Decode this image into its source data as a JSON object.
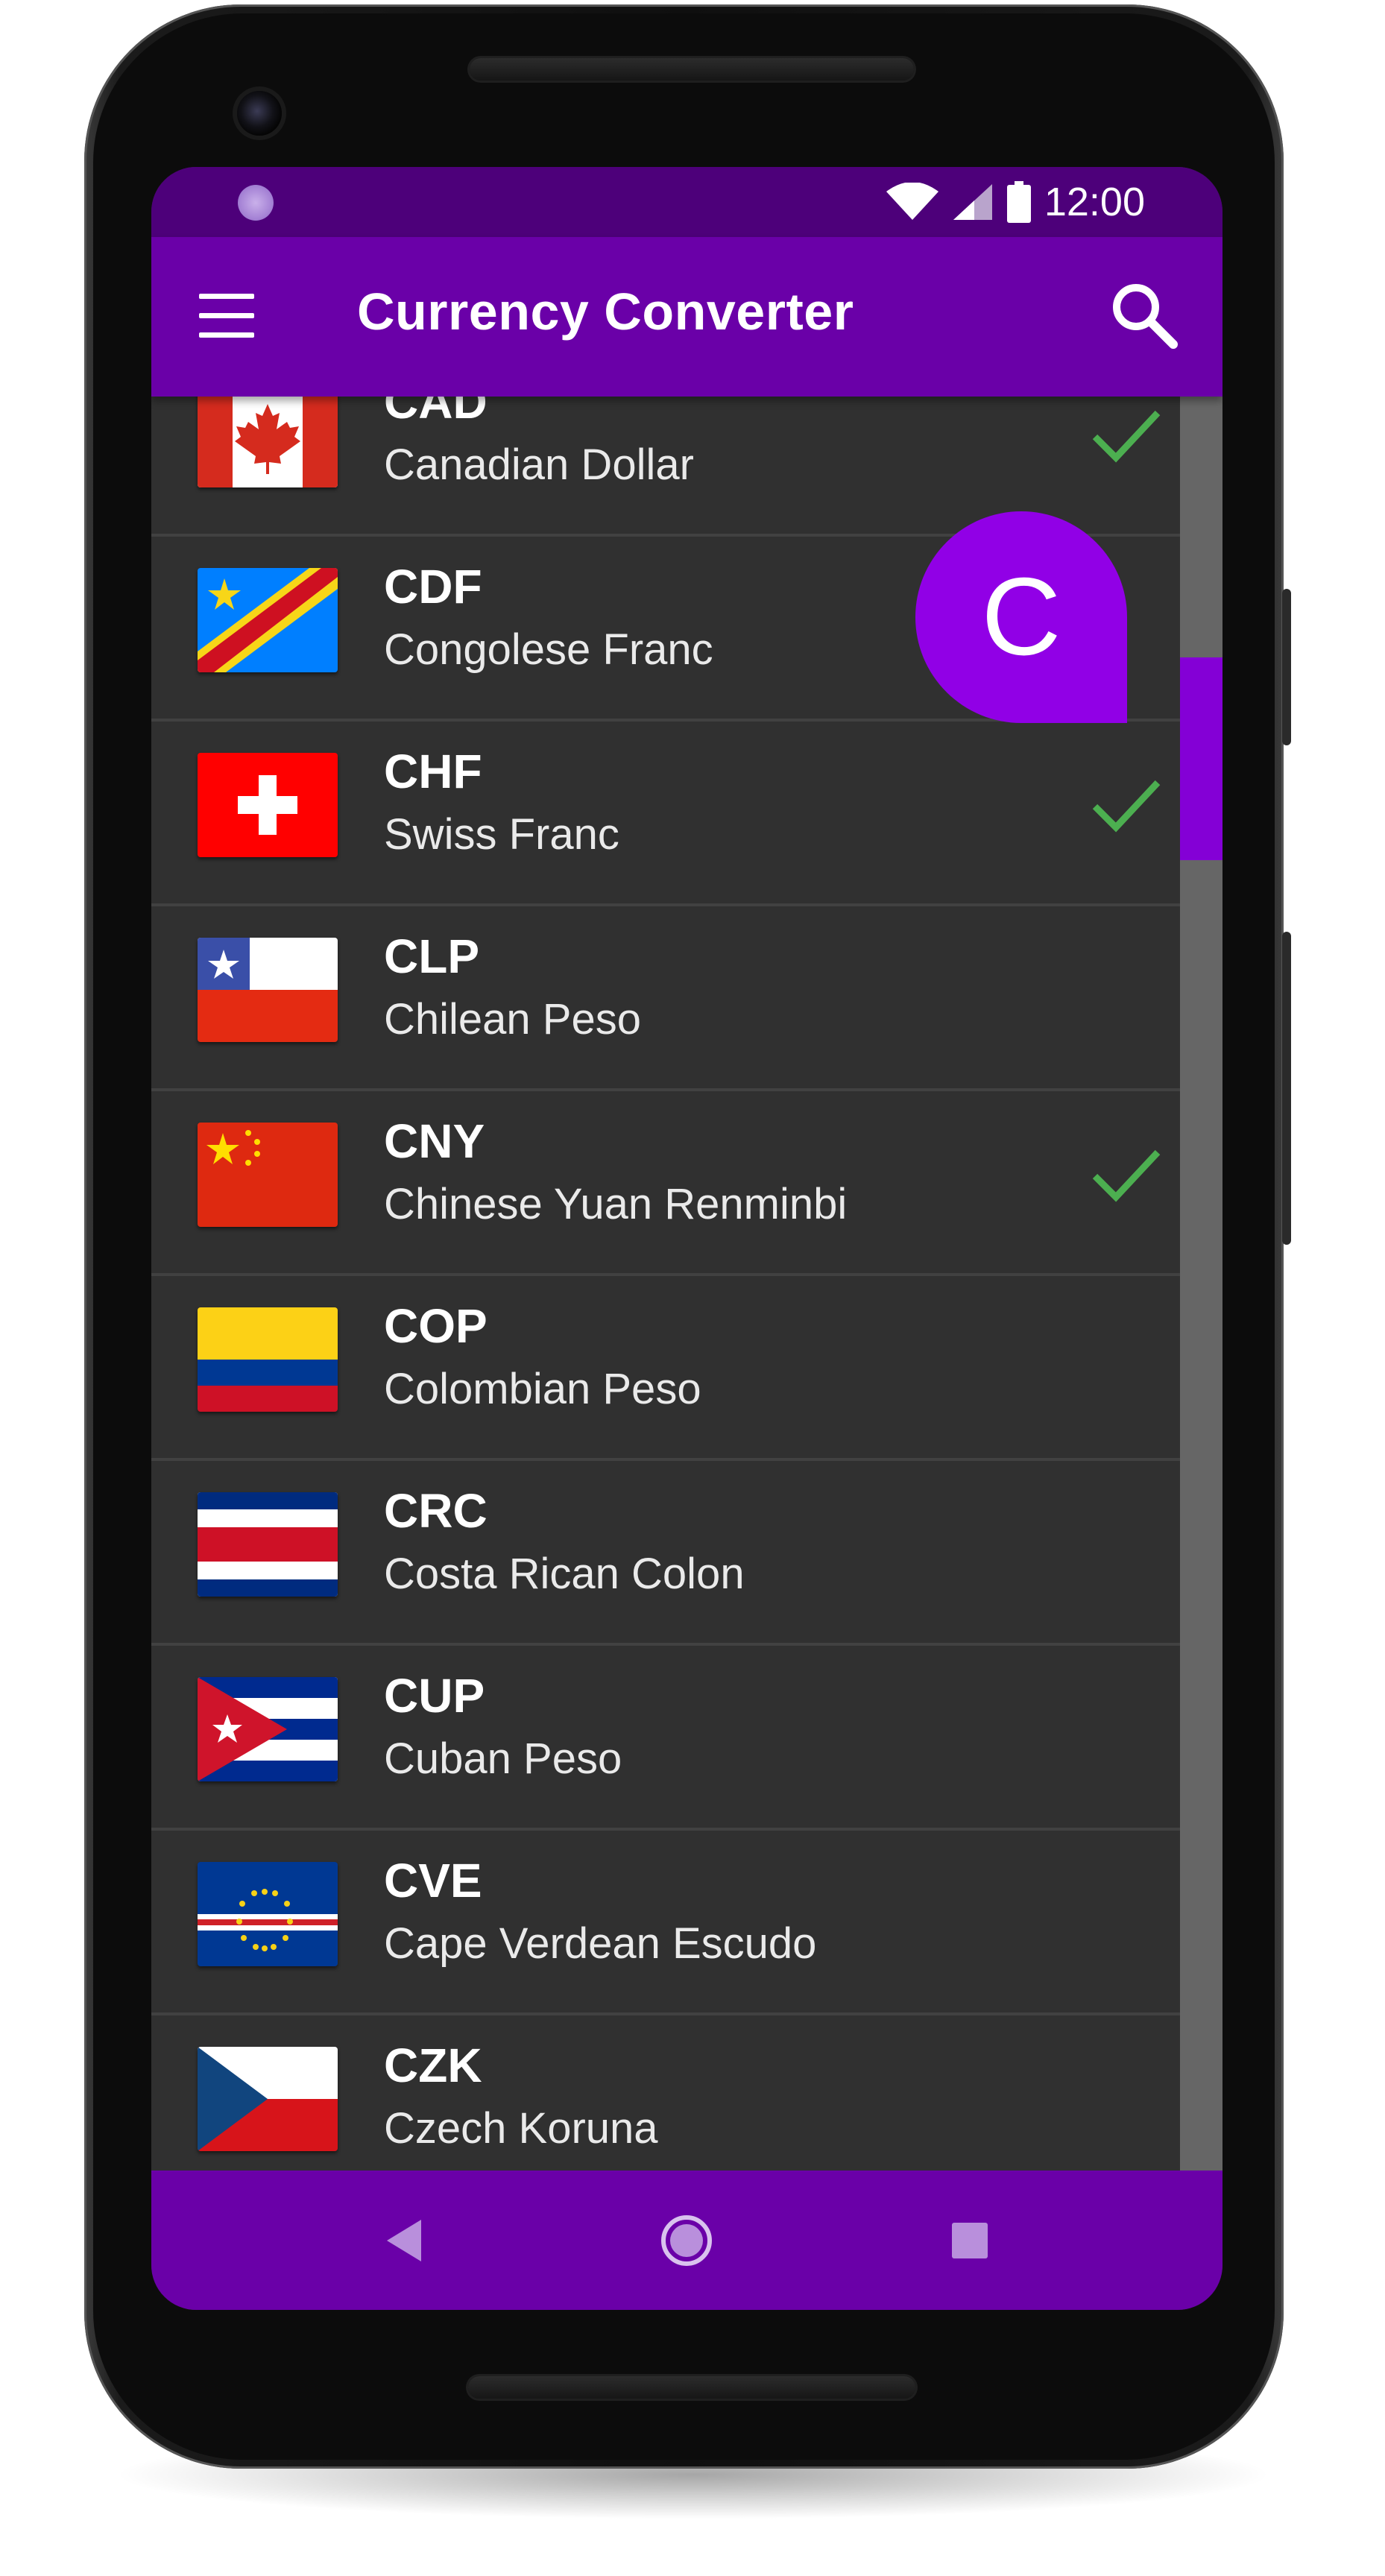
{
  "status_bar": {
    "time": "12:00",
    "icons": [
      "notification-icon",
      "wifi-icon",
      "cell-signal-icon",
      "battery-icon"
    ]
  },
  "app_bar": {
    "title": "Currency Converter",
    "menu_icon": "menu-icon",
    "search_icon": "search-icon"
  },
  "fast_scroll_letter": "C",
  "currencies": [
    {
      "code": "CAD",
      "name": "Canadian Dollar",
      "selected": true
    },
    {
      "code": "CDF",
      "name": "Congolese Franc",
      "selected": false
    },
    {
      "code": "CHF",
      "name": "Swiss Franc",
      "selected": true
    },
    {
      "code": "CLP",
      "name": "Chilean Peso",
      "selected": false
    },
    {
      "code": "CNY",
      "name": "Chinese Yuan Renminbi",
      "selected": true
    },
    {
      "code": "COP",
      "name": "Colombian Peso",
      "selected": false
    },
    {
      "code": "CRC",
      "name": "Costa Rican Colon",
      "selected": false
    },
    {
      "code": "CUP",
      "name": "Cuban Peso",
      "selected": false
    },
    {
      "code": "CVE",
      "name": "Cape Verdean Escudo",
      "selected": false
    },
    {
      "code": "CZK",
      "name": "Czech Koruna",
      "selected": false
    }
  ],
  "nav_bar": {
    "back": "back-icon",
    "home": "home-icon",
    "recents": "recents-icon"
  },
  "colors": {
    "primary": "#6a00a8",
    "primary_dark": "#4d007a",
    "accent": "#9100e6",
    "check": "#4caf50",
    "background": "#303030"
  }
}
